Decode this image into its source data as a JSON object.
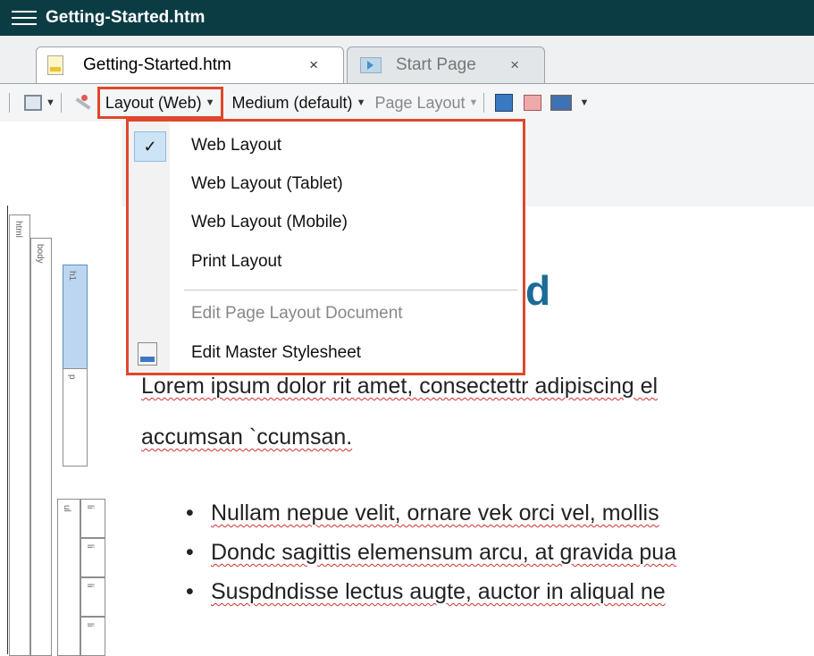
{
  "window": {
    "title": "Getting-Started.htm"
  },
  "tabs": [
    {
      "label": "Getting-Started.htm",
      "close": "×"
    },
    {
      "label": "Start Page",
      "close": "×"
    }
  ],
  "toolbar": {
    "layout_label": "Layout (Web)",
    "medium_label": "Medium (default)",
    "page_layout_label": "Page Layout"
  },
  "menu": {
    "items": [
      {
        "label": "Web Layout",
        "checked": true
      },
      {
        "label": "Web Layout (Tablet)"
      },
      {
        "label": "Web Layout (Mobile)"
      },
      {
        "label": "Print Layout"
      },
      {
        "label": "Edit Page Layout Document",
        "disabled": true
      },
      {
        "label": "Edit Master Stylesheet"
      }
    ],
    "check_glyph": "✓"
  },
  "structure_bar": {
    "html": "html",
    "body": "body",
    "h1": "h1",
    "p": "p",
    "ul": "ul",
    "li": "li"
  },
  "document": {
    "heading_tail": "d",
    "para_line1": "Lorem ipsum dolor rit amet, consectettr adipiscing el",
    "para_line2": "accumsan `ccumsan.",
    "bullets": [
      "Nullam nepue velit, ornare vek orci vel, mollis",
      "Dondc sagittis elemensum arcu, at gravida pua",
      "Suspdndisse lectus augte, auctor in aliqual ne"
    ]
  },
  "colors": {
    "titlebar": "#0b3c44",
    "highlight": "#e0472b",
    "heading": "#1a6b98"
  }
}
